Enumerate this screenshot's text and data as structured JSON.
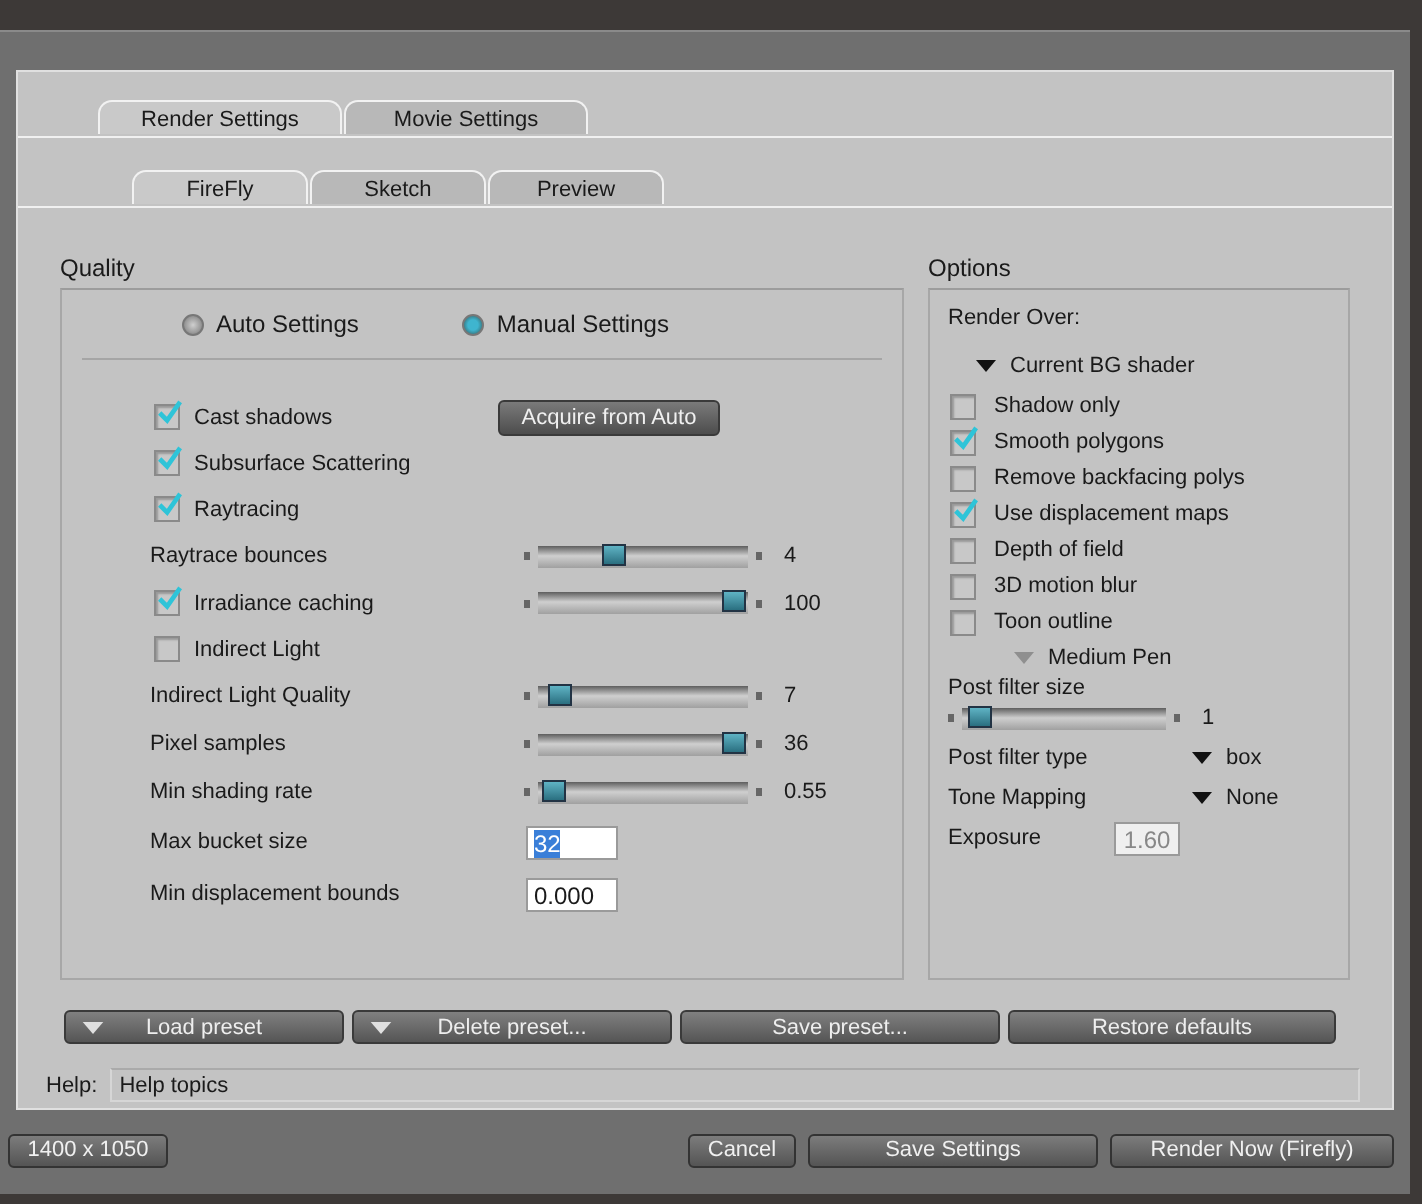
{
  "tabs": [
    {
      "label": "Render Settings",
      "selected": true
    },
    {
      "label": "Movie Settings",
      "selected": false
    }
  ],
  "subtabs": [
    {
      "label": "FireFly",
      "selected": true
    },
    {
      "label": "Sketch",
      "selected": false
    },
    {
      "label": "Preview",
      "selected": false
    }
  ],
  "quality": {
    "title": "Quality",
    "modes": [
      {
        "label": "Auto Settings",
        "selected": false
      },
      {
        "label": "Manual Settings",
        "selected": true
      }
    ],
    "acquire_button": "Acquire from Auto",
    "rows": [
      {
        "kind": "checkbox",
        "label": "Cast shadows",
        "checked": true
      },
      {
        "kind": "checkbox",
        "label": "Subsurface Scattering",
        "checked": true
      },
      {
        "kind": "checkbox",
        "label": "Raytracing",
        "checked": true
      },
      {
        "kind": "slider",
        "label": "Raytrace bounces",
        "level": 0.35,
        "reading": "4"
      },
      {
        "kind": "checkslider",
        "label": "Irradiance caching",
        "checked": true,
        "level": 1,
        "reading": "100"
      },
      {
        "kind": "checkbox",
        "label": "Indirect Light",
        "checked": false
      },
      {
        "kind": "slider",
        "label": "Indirect Light Quality",
        "level": 0.05,
        "reading": "7"
      },
      {
        "kind": "slider",
        "label": "Pixel samples",
        "level": 1,
        "reading": "36"
      },
      {
        "kind": "slider",
        "label": "Min shading rate",
        "level": 0.02,
        "reading": "0.55"
      },
      {
        "kind": "field",
        "label": "Max bucket size",
        "value": "32",
        "selected": true
      },
      {
        "kind": "field",
        "label": "Min displacement bounds",
        "value": "0.000",
        "selected": false
      }
    ]
  },
  "options": {
    "title": "Options",
    "render_over_label": "Render Over:",
    "render_over": "Current BG shader",
    "checkboxes": [
      {
        "label": "Shadow only",
        "checked": false
      },
      {
        "label": "Smooth polygons",
        "checked": true
      },
      {
        "label": "Remove backfacing polys",
        "checked": false
      },
      {
        "label": "Use displacement maps",
        "checked": true
      },
      {
        "label": "Depth of field",
        "checked": false
      },
      {
        "label": "3D motion blur",
        "checked": false
      },
      {
        "label": "Toon outline",
        "checked": false
      }
    ],
    "toon_pen": {
      "value": "Medium Pen",
      "disabled": true
    },
    "post_filter_size": {
      "label": "Post filter size",
      "level": 0.03,
      "reading": "1"
    },
    "post_filter_type": {
      "label": "Post filter type",
      "value": "box"
    },
    "tone_mapping": {
      "label": "Tone Mapping",
      "value": "None"
    },
    "exposure": {
      "label": "Exposure",
      "value": "1.60",
      "disabled": true
    }
  },
  "presets": [
    {
      "label": "Load preset",
      "menu": true
    },
    {
      "label": "Delete preset...",
      "menu": true
    },
    {
      "label": "Save preset...",
      "menu": false
    },
    {
      "label": "Restore defaults",
      "menu": false
    }
  ],
  "help": {
    "label": "Help:",
    "text": "Help topics"
  },
  "status_bar": {
    "resolution": "1400 x 1050",
    "buttons": [
      "Cancel",
      "Save Settings",
      "Render Now (Firefly)"
    ]
  }
}
